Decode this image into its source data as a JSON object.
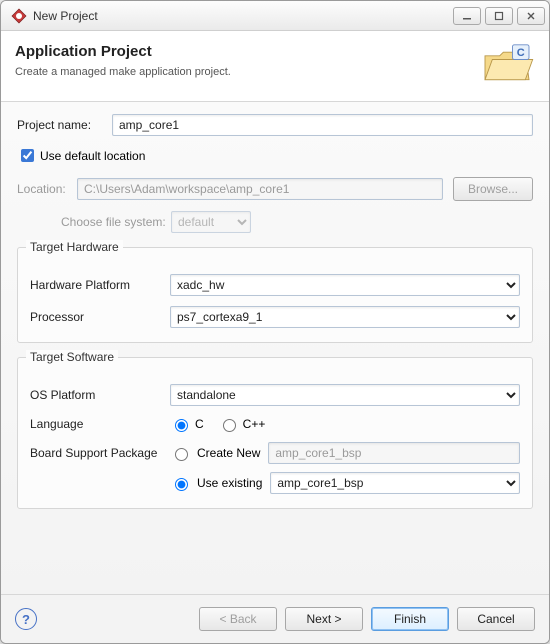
{
  "window": {
    "title": "New Project"
  },
  "header": {
    "title": "Application Project",
    "subtitle": "Create a managed make application project."
  },
  "project_name": {
    "label": "Project name:",
    "value": "amp_core1"
  },
  "use_default_location": {
    "label": "Use default location",
    "checked": true
  },
  "location": {
    "label": "Location:",
    "value": "C:\\Users\\Adam\\workspace\\amp_core1",
    "browse": "Browse..."
  },
  "file_system": {
    "label": "Choose file system:",
    "value": "default"
  },
  "target_hardware": {
    "legend": "Target Hardware",
    "hardware_platform": {
      "label": "Hardware Platform",
      "value": "xadc_hw"
    },
    "processor": {
      "label": "Processor",
      "value": "ps7_cortexa9_1"
    }
  },
  "target_software": {
    "legend": "Target Software",
    "os_platform": {
      "label": "OS Platform",
      "value": "standalone"
    },
    "language": {
      "label": "Language",
      "c": "C",
      "cpp": "C++",
      "selected": "C"
    },
    "bsp": {
      "label": "Board Support Package",
      "create_new": {
        "label": "Create New",
        "value": "amp_core1_bsp"
      },
      "use_existing": {
        "label": "Use existing",
        "value": "amp_core1_bsp"
      },
      "selected": "use_existing"
    }
  },
  "buttons": {
    "back": "< Back",
    "next": "Next >",
    "finish": "Finish",
    "cancel": "Cancel"
  }
}
